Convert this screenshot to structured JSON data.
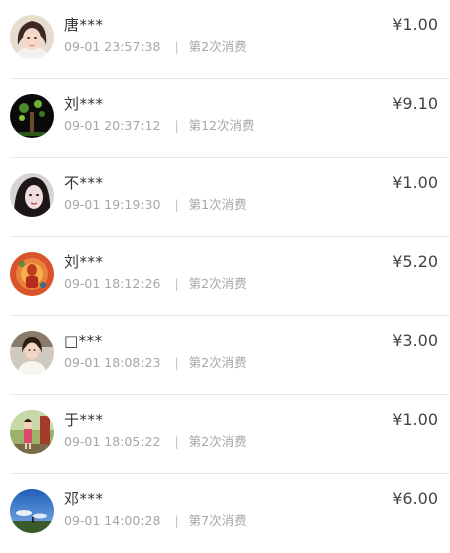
{
  "records": [
    {
      "name": "唐***",
      "datetime": "09-01 23:57:38",
      "count": "第2次消费",
      "amount": "¥1.00",
      "avatar": "avatar-woman-portrait"
    },
    {
      "name": "刘***",
      "datetime": "09-01 20:37:12",
      "count": "第12次消费",
      "amount": "¥9.10",
      "avatar": "avatar-tree"
    },
    {
      "name": "不***",
      "datetime": "09-01 19:19:30",
      "count": "第1次消费",
      "amount": "¥1.00",
      "avatar": "avatar-woman-dark-hair"
    },
    {
      "name": "刘***",
      "datetime": "09-01 18:12:26",
      "count": "第2次消费",
      "amount": "¥5.20",
      "avatar": "avatar-deity-artwork"
    },
    {
      "name": "□***",
      "datetime": "09-01 18:08:23",
      "count": "第2次消费",
      "amount": "¥3.00",
      "avatar": "avatar-woman-white-dress"
    },
    {
      "name": "于***",
      "datetime": "09-01 18:05:22",
      "count": "第2次消费",
      "amount": "¥1.00",
      "avatar": "avatar-child-outdoor"
    },
    {
      "name": "邓***",
      "datetime": "09-01 14:00:28",
      "count": "第7次消费",
      "amount": "¥6.00",
      "avatar": "avatar-sky-landscape"
    }
  ]
}
